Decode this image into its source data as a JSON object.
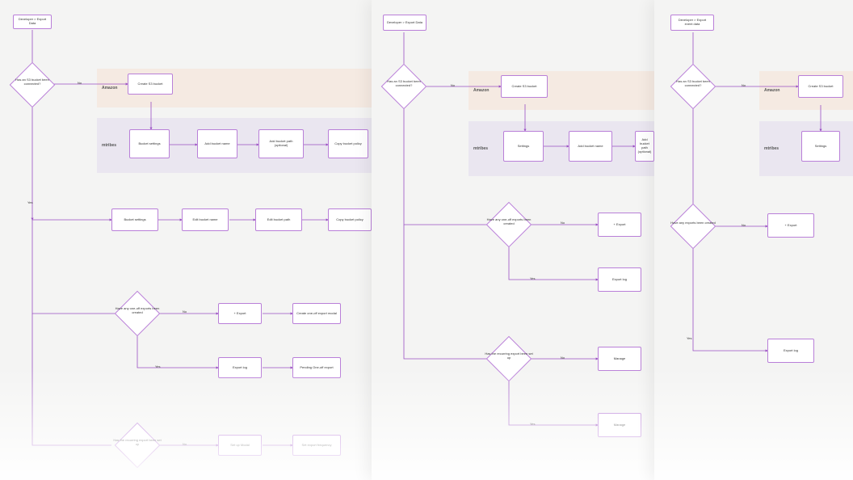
{
  "edges": {
    "yes": "Yes",
    "no": "No"
  },
  "bands": {
    "amazon": "Amazon",
    "mtribes": "mtribes"
  },
  "p1": {
    "start": "Developer > Export Data",
    "d_bucket": "Has an S3 bucket been connected?",
    "create_bucket": "Create S3 bucket",
    "bucket_settings": "Bucket settings",
    "add_bucket_name": "Add bucket name",
    "add_bucket_path": "Add bucket path (optional)",
    "copy_bucket_policy": "Copy bucket policy",
    "bucket_settings2": "Bucket settings",
    "edit_bucket_name": "Edit bucket name",
    "edit_bucket_path": "Edit bucket path",
    "copy_bucket_policy2": "Copy bucket policy",
    "d_oneoff": "Have any one-off exports been created",
    "plus_export": "+ Export",
    "create_oneoff_modal": "Create one-off export modal",
    "export_log": "Export log",
    "pending_oneoff": "Pending One-off export",
    "d_recurring": "Has the recurring export been set up",
    "setup_modal": "Set up Modal",
    "set_export_freq": "Set export frequency"
  },
  "p2": {
    "start": "Developer > Export Data",
    "d_bucket": "Has an S3 bucket been connected?",
    "create_bucket": "Create S3 bucket",
    "settings": "Settings",
    "add_bucket_name": "Add bucket name",
    "add_bucket_path": "Add bucket path (optional)",
    "d_oneoff": "Have any one-off exports been created",
    "plus_export": "+ Export",
    "export_log": "Export log",
    "d_recurring": "Has the recurring export been set up",
    "manage1": "Manage",
    "manage2": "Manage"
  },
  "p3": {
    "start": "Developer > Export event data",
    "d_bucket": "Has an S3 bucket been connected?",
    "create_bucket": "Create S3 bucket",
    "settings": "Settings",
    "d_exports": "Have any exports been created",
    "plus_export": "+ Export",
    "export_log": "Export log"
  }
}
